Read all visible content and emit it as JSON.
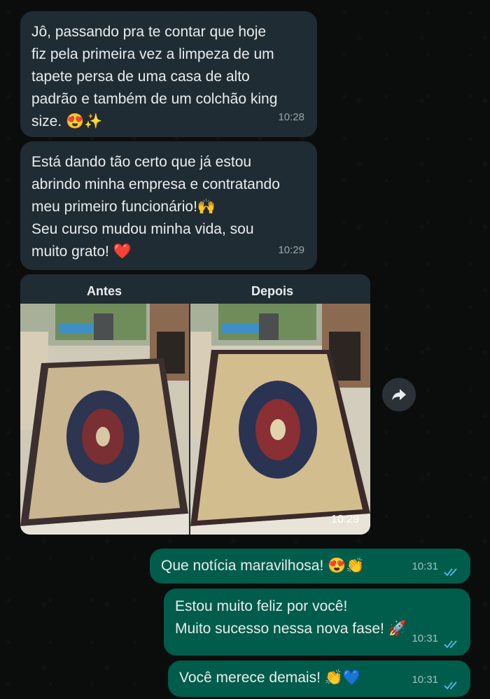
{
  "messages": [
    {
      "text": "Jô, passando pra te contar que hoje\nfiz pela primeira vez a limpeza de um\ntapete persa de uma casa de alto\npadrão e também de um colchão king\nsize. 😍✨",
      "time": "10:28"
    },
    {
      "text": "Está dando tão certo que já estou\nabrindo minha empresa e contratando\nmeu primeiro funcionário!🙌\nSeu curso mudou minha vida, sou\nmuito grato! ❤️",
      "time": "10:29"
    }
  ],
  "image_message": {
    "before_label": "Antes",
    "after_label": "Depois",
    "time": "10:29"
  },
  "replies": [
    {
      "text": "Que notícia maravilhosa! 😍👏",
      "time": "10:31"
    },
    {
      "text": "Estou muito feliz por você!\nMuito sucesso nessa nova fase! 🚀",
      "time": "10:31"
    },
    {
      "text": "Você merece demais! 👏💙",
      "time": "10:31"
    }
  ],
  "colors": {
    "incoming_bubble": "#202c33",
    "outgoing_bubble": "#005c4b",
    "read_ticks": "#53bdeb"
  },
  "icons": {
    "forward": "forward-arrow-icon",
    "read": "double-check-icon"
  }
}
